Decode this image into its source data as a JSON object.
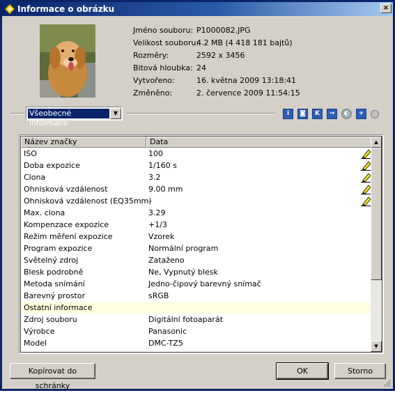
{
  "window": {
    "title": "Informace o obrázku",
    "close_glyph": "×"
  },
  "file_info": [
    {
      "label": "Jméno souboru:",
      "value": "P1000082.JPG"
    },
    {
      "label": "Velikost souboru:",
      "value": "4.2 MB (4 418 181 bajtů)"
    },
    {
      "label": "Rozměry:",
      "value": "2592 x 3456"
    },
    {
      "label": "Bitová hloubka:",
      "value": "24"
    },
    {
      "label": "Vytvořeno:",
      "value": "16. května 2009 13:18:41"
    },
    {
      "label": "Změněno:",
      "value": "2. července 2009 11:54:15"
    }
  ],
  "category_select": {
    "selected": "Všeobecné informace"
  },
  "toolbar_icons": [
    "info-icon",
    "camera-icon",
    "k-icon",
    "export-icon",
    "gps-icon",
    "add-icon",
    "status-dot-icon"
  ],
  "table": {
    "columns": [
      "Název značky",
      "Data"
    ],
    "rows": [
      {
        "name": "ISO",
        "value": "100",
        "editable": true
      },
      {
        "name": "Doba expozice",
        "value": "1/160 s",
        "editable": true
      },
      {
        "name": "Clona",
        "value": "3.2",
        "editable": true
      },
      {
        "name": "Ohnisková vzdálenost",
        "value": "9.00 mm",
        "editable": true
      },
      {
        "name": "Ohnisková vzdálenost (EQ35mm)",
        "value": "-",
        "editable": true
      },
      {
        "name": "Max. clona",
        "value": "3.29",
        "editable": false
      },
      {
        "name": "Kompenzace expozice",
        "value": "+1/3",
        "editable": false
      },
      {
        "name": "Režim měření expozice",
        "value": "Vzorek",
        "editable": false
      },
      {
        "name": "Program expozice",
        "value": "Normální program",
        "editable": false
      },
      {
        "name": "Světelný zdroj",
        "value": "Zataženo",
        "editable": false
      },
      {
        "name": "Blesk podrobně",
        "value": "Ne, Vypnutý blesk",
        "editable": false
      },
      {
        "name": "Metoda snímání",
        "value": "Jedno-čipový barevný snímač",
        "editable": false
      },
      {
        "name": "Barevný prostor",
        "value": "sRGB",
        "editable": false
      },
      {
        "name": "Ostatní informace",
        "value": "",
        "editable": false,
        "section": true
      },
      {
        "name": "Zdroj souboru",
        "value": "Digitální fotoaparát",
        "editable": false
      },
      {
        "name": "Výrobce",
        "value": "Panasonic",
        "editable": false
      },
      {
        "name": "Model",
        "value": "DMC-TZ5",
        "editable": false
      }
    ]
  },
  "buttons": {
    "copy": "Kopírovat do schránky",
    "ok": "OK",
    "cancel": "Storno"
  }
}
